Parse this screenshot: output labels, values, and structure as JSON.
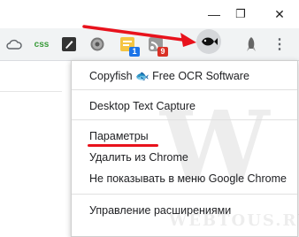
{
  "window": {
    "minimize_glyph": "—",
    "restore_glyph": "❐",
    "close_glyph": "✕"
  },
  "toolbar": {
    "extensions": [
      {
        "icon": "cloud-icon",
        "text": ""
      },
      {
        "icon": "css-icon",
        "text": "css"
      },
      {
        "icon": "stylus-icon",
        "text": ""
      },
      {
        "icon": "gear-icon",
        "text": ""
      },
      {
        "icon": "rss-icon",
        "text": "",
        "badge": "1"
      },
      {
        "icon": "feed-icon",
        "text": "",
        "badge": "9"
      },
      {
        "icon": "copyfish-icon",
        "text": ""
      },
      {
        "icon": "rocket-icon",
        "text": ""
      }
    ],
    "menu_glyph": "⋮",
    "badge_colors": {
      "blue": "#1a73e8",
      "red": "#d93025"
    }
  },
  "menu": {
    "title": "Copyfish 🐟 Free OCR Software",
    "items": [
      "Desktop Text Capture",
      "Параметры",
      "Удалить из Chrome",
      "Не показывать в меню Google Chrome",
      "Управление расширениями"
    ]
  },
  "annotation_color": "#e8121c",
  "watermark": {
    "letter": "W",
    "text": "WEBTOUS.RU"
  }
}
